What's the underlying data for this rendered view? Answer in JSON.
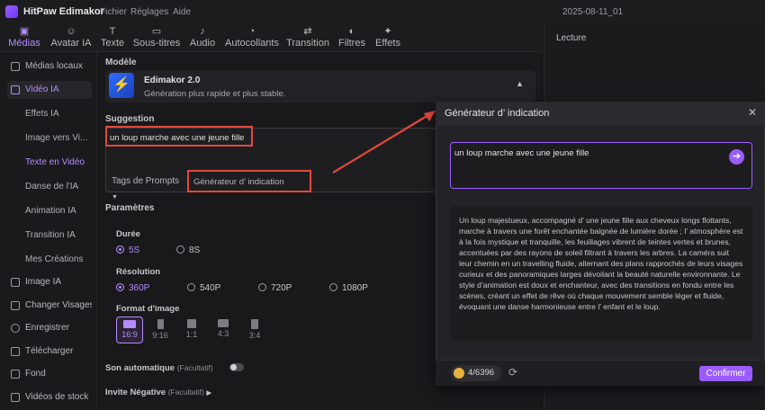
{
  "app": {
    "title": "HitPaw Edimakor",
    "menu": [
      "Fichier",
      "Réglages",
      "Aide"
    ],
    "project": "2025-08-11_01"
  },
  "toolbar": {
    "tabs": [
      "Médias",
      "Avatar IA",
      "Texte",
      "Sous-titres",
      "Audio",
      "Autocollants",
      "Transition",
      "Filtres",
      "Effets"
    ]
  },
  "sidebar": {
    "items": [
      "Médias locaux",
      "Vidéo IA"
    ],
    "sub": [
      "Effets IA",
      "Image vers Vi...",
      "Texte en Vidéo",
      "Danse de l'IA",
      "Animation IA",
      "Transition IA",
      "Mes Créations"
    ],
    "bottom": [
      "Image IA",
      "Changer Visages",
      "Enregistrer",
      "Télécharger",
      "Fond",
      "Vidéos de stock"
    ]
  },
  "main": {
    "model_label": "Modèle",
    "model_name": "Edimakor 2.0",
    "model_desc": "Génération plus rapide et plus stable.",
    "suggestion_label": "Suggestion",
    "prompt_text": "un loup marche avec une jeune fille",
    "tags_label": "Tags de Prompts",
    "generator_label": "Générateur d’ indication",
    "params_label": "Paramètres",
    "duration_label": "Durée",
    "durations": [
      "5S",
      "8S"
    ],
    "resolution_label": "Résolution",
    "resolutions": [
      "360P",
      "540P",
      "720P",
      "1080P"
    ],
    "format_label": "Format d'image",
    "formats": [
      "16:9",
      "9:16",
      "1:1",
      "4:3",
      "3:4"
    ],
    "auto_sound_label": "Son automatique",
    "auto_sound_hint": "(Facultatif)",
    "negative_label": "Invite Négative",
    "negative_hint": "(Facultatif)"
  },
  "right_panel": {
    "title": "Lecture"
  },
  "dialog": {
    "title": "Générateur d’ indication",
    "input_text": "un loup marche avec une jeune fille",
    "result": "Un loup majestueux, accompagné d’ une jeune fille aux cheveux longs flottants, marche à travers une forêt enchantée baignée de lumière dorée ; l’ atmosphère est à la fois mystique et tranquille, les feuillages vibrent de teintes vertes et brunes, accentuées par des rayons de soleil filtrant à travers les arbres. La caméra suit leur chemin en un travelling fluide, alternant des plans rapprochés de leurs visages curieux et des panoramiques larges dévoilant la beauté naturelle environnante. Le style d’animation est doux et enchanteur, avec des transitions en fondu entre les scènes, créant un effet de rêve où chaque mouvement semble léger et fluide, évoquant une danse harmonieuse entre l’ enfant et le loup.",
    "credits": "4/6396",
    "confirm": "Confirmer"
  }
}
